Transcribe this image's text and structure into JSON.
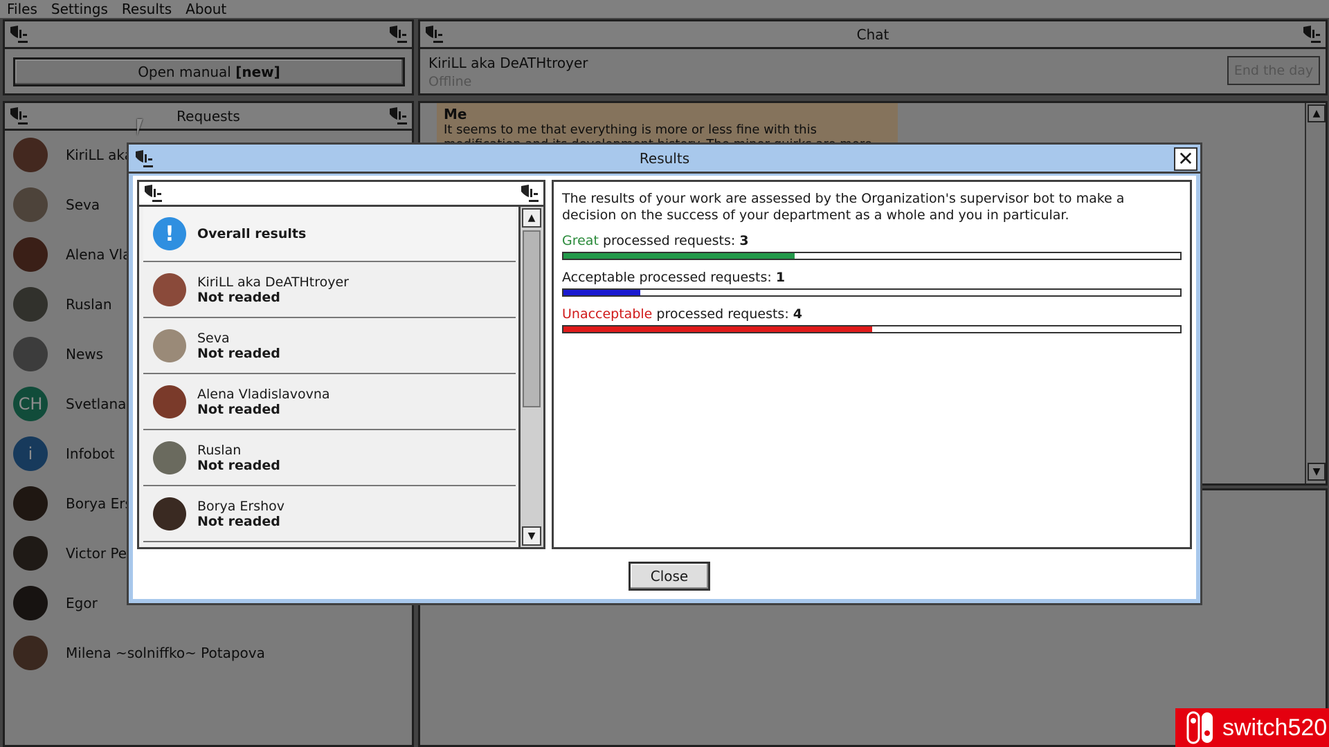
{
  "menu": {
    "items": [
      "Files",
      "Settings",
      "Results",
      "About"
    ]
  },
  "left_top": {
    "manual_button_text": "Open manual ",
    "manual_button_badge": "[new]"
  },
  "requests": {
    "title": "Requests",
    "items": [
      {
        "name": "KiriLL aka D",
        "initials": "",
        "color": "#7a4a3a"
      },
      {
        "name": "Seva",
        "initials": "",
        "color": "#8c7a6a"
      },
      {
        "name": "Alena Vladi",
        "initials": "",
        "color": "#6a3a2a"
      },
      {
        "name": "Ruslan",
        "initials": "",
        "color": "#5a5a50"
      },
      {
        "name": "News",
        "initials": "",
        "color": "#6e6e6e"
      },
      {
        "name": "Svetlana (C",
        "initials": "CH",
        "color": "#1f8a6a"
      },
      {
        "name": "Infobot",
        "initials": "i",
        "color": "#2a6aa8"
      },
      {
        "name": "Borya Ersh",
        "initials": "",
        "color": "#3a2a22"
      },
      {
        "name": "Victor Petr",
        "initials": "",
        "color": "#3a3028"
      },
      {
        "name": "Egor",
        "initials": "",
        "color": "#2a2420"
      },
      {
        "name": "Milena ~solniffko~ Potapova",
        "initials": "",
        "color": "#6a4a3a"
      }
    ]
  },
  "chat": {
    "title": "Chat",
    "contact_name": "KiriLL aka DeATHtroyer",
    "contact_status": "Offline",
    "end_day_label": "End the day",
    "message_author": "Me",
    "message_text": "It seems to me that everything is more or less fine with this modification and its development history. The minor quirks are more"
  },
  "dialog": {
    "title": "Results",
    "close_label": "Close",
    "list": [
      {
        "title": "Overall results",
        "subtitle": "",
        "kind": "info"
      },
      {
        "title": "KiriLL aka DeATHtroyer",
        "subtitle": "Not readed",
        "color": "#8a4a3a"
      },
      {
        "title": "Seva",
        "subtitle": "Not readed",
        "color": "#9a8a78"
      },
      {
        "title": "Alena Vladislavovna",
        "subtitle": "Not readed",
        "color": "#7a3a2a"
      },
      {
        "title": "Ruslan",
        "subtitle": "Not readed",
        "color": "#6a6a5e"
      },
      {
        "title": "Borya Ershov",
        "subtitle": "Not readed",
        "color": "#3a2a22"
      }
    ],
    "description": "The results of your work are assessed by the Organization's supervisor bot to make a decision on the success of your department as a whole and you in particular.",
    "results": [
      {
        "prefix": "Great",
        "prefix_color": "#2a8a3a",
        "label": " processed requests: ",
        "value": "3",
        "fill_color": "#239a4a",
        "fraction": 0.375
      },
      {
        "prefix": "",
        "prefix_color": "#1a1a1a",
        "label": "Acceptable processed requests: ",
        "value": "1",
        "fill_color": "#1a1ad0",
        "fraction": 0.125
      },
      {
        "prefix": "Unacceptable",
        "prefix_color": "#d01a1a",
        "label": " processed requests: ",
        "value": "4",
        "fill_color": "#e01a1a",
        "fraction": 0.5
      }
    ]
  },
  "watermark": {
    "text": "switch520"
  }
}
